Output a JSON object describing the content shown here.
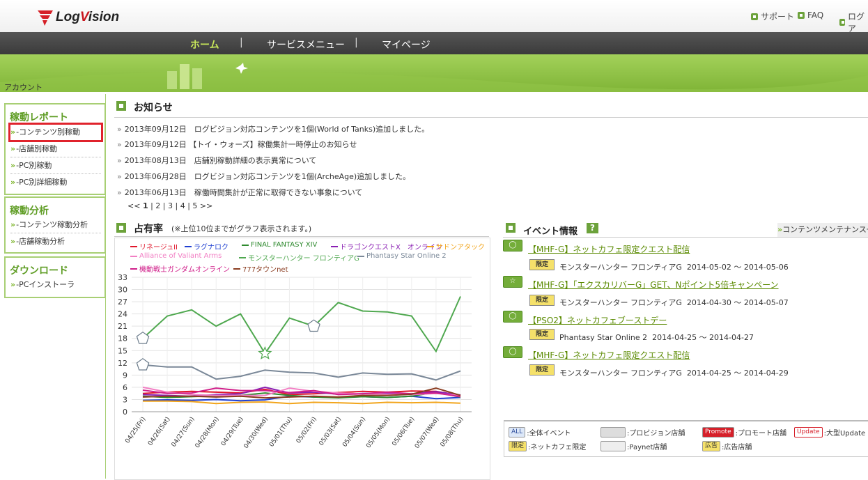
{
  "header": {
    "logo": "LogVision",
    "top_links": [
      "サポート",
      "FAQ",
      "ログア"
    ]
  },
  "nav": {
    "items": [
      "ホーム",
      "サービスメニュー",
      "マイページ"
    ],
    "active": "ホーム",
    "separator": "|"
  },
  "breadcrumb": "アカウント",
  "sidebar": {
    "sections": [
      {
        "title": "稼動レポート",
        "items": [
          "-コンテンツ別稼動",
          "-店舗別稼動",
          "-PC別稼動",
          "-PC別詳細稼動"
        ]
      },
      {
        "title": "稼動分析",
        "items": [
          "-コンテンツ稼動分析",
          "-店舗稼動分析"
        ]
      },
      {
        "title": "ダウンロード",
        "items": [
          "-PCインストーラ"
        ]
      }
    ]
  },
  "news": {
    "title": "お知らせ",
    "items": [
      "2013年09月12日　ログビジョン対応コンテンツを1個(World of Tanks)追加しました。",
      "2013年09月12日 【トイ・ウォーズ】稼働集計一時停止のお知らせ",
      "2013年08月13日　店舗別稼動詳細の表示異常について",
      "2013年06月28日　ログビジョン対応コンテンツを1個(ArcheAge)追加しました。",
      "2013年06月13日　稼働時間集計が正常に取得できない事象について"
    ],
    "pager": {
      "prev": "<<",
      "pages": [
        "1",
        "2",
        "3",
        "4",
        "5"
      ],
      "next": ">>",
      "current": "1"
    }
  },
  "share": {
    "title": "占有率",
    "note": "(※上位10位までがグラフ表示されます。)"
  },
  "chart_data": {
    "type": "line",
    "x": [
      "04/25(Fri)",
      "04/26(Sat)",
      "04/27(Sun)",
      "04/28(Mon)",
      "04/29(Tue)",
      "04/30(Wed)",
      "05/01(Thu)",
      "05/02(Fri)",
      "05/03(Sat)",
      "05/04(Sun)",
      "05/05(Mon)",
      "05/06(Tue)",
      "05/07(Wed)",
      "05/08(Thu)"
    ],
    "ylim": [
      0,
      33
    ],
    "yticks": [
      0,
      3,
      6,
      9,
      12,
      15,
      18,
      21,
      24,
      27,
      30,
      33
    ],
    "grid": true,
    "legend_position": "top",
    "series": [
      {
        "name": "リネージュII",
        "color": "#e0162b",
        "values": [
          4.5,
          4.8,
          5.0,
          4.8,
          4.6,
          5.5,
          4.2,
          4.4,
          4.7,
          5.0,
          4.8,
          5.1,
          5.0,
          4.0
        ]
      },
      {
        "name": "ラグナロク",
        "color": "#1f3fd1",
        "values": [
          2.8,
          2.9,
          2.8,
          3.0,
          2.7,
          2.9,
          3.8,
          3.6,
          3.5,
          3.7,
          3.5,
          3.8,
          3.2,
          3.5
        ]
      },
      {
        "name": "FINAL FANTASY XIV",
        "color": "#2f8a2f",
        "values": [
          3.8,
          3.5,
          3.7,
          3.9,
          4.0,
          4.6,
          4.0,
          3.6,
          3.4,
          3.7,
          3.5,
          3.8,
          4.8,
          3.6
        ]
      },
      {
        "name": "ドラゴンクエストX　オンライン",
        "color": "#8a1fb3",
        "values": [
          4.2,
          4.0,
          3.8,
          4.2,
          4.4,
          6.0,
          4.6,
          4.8,
          4.3,
          4.5,
          4.6,
          4.4,
          4.9,
          4.1
        ]
      },
      {
        "name": "サドンアタック",
        "color": "#f2a51c",
        "values": [
          2.6,
          2.6,
          2.5,
          2.0,
          2.3,
          2.4,
          2.0,
          2.3,
          2.2,
          2.0,
          2.3,
          2.2,
          2.3,
          2.1
        ]
      },
      {
        "name": "Alliance of Valiant Arms",
        "color": "#f27fc4",
        "values": [
          6.0,
          4.8,
          4.2,
          4.0,
          4.0,
          4.0,
          5.8,
          5.0,
          4.6,
          4.4,
          4.3,
          4.2,
          4.5,
          4.0
        ]
      },
      {
        "name": "モンスターハンター フロンティアG",
        "color": "#4fa84f",
        "values": [
          18.0,
          23.5,
          25.0,
          21.0,
          24.0,
          14.3,
          23.0,
          21.0,
          26.8,
          24.7,
          24.5,
          23.5,
          14.8,
          28.3
        ]
      },
      {
        "name": "Phantasy Star Online 2",
        "color": "#7a8898",
        "values": [
          11.5,
          11.0,
          11.0,
          8.0,
          8.7,
          10.2,
          9.7,
          9.5,
          8.5,
          9.5,
          9.2,
          9.3,
          7.8,
          10.0
        ]
      },
      {
        "name": "機動戦士ガンダムオンライン",
        "color": "#d01f8a",
        "values": [
          5.3,
          4.5,
          4.6,
          5.8,
          5.2,
          5.2,
          4.7,
          5.2,
          4.2,
          4.4,
          4.8,
          4.4,
          4.6,
          3.7
        ]
      },
      {
        "name": "777タウンnet",
        "color": "#8a3b1f",
        "values": [
          3.6,
          3.8,
          3.8,
          3.6,
          3.8,
          3.4,
          3.6,
          3.8,
          3.6,
          4.0,
          4.0,
          4.3,
          5.8,
          4.0
        ]
      }
    ]
  },
  "events": {
    "title": "イベント情報",
    "help": "?",
    "maint_link": "コンテンツメンテナンス一覧",
    "items": [
      {
        "badge": "◯",
        "title": "【MHF-G】ネットカフェ限定クエスト配信",
        "tag": "限定",
        "game": "モンスターハンター フロンティアG",
        "period": "2014-05-02 ～ 2014-05-06"
      },
      {
        "badge": "☆",
        "title": "【MHF-G】「エクスカリバーG」GET、Nポイント5倍キャンペーン",
        "tag": "限定",
        "game": "モンスターハンター フロンティアG",
        "period": "2014-04-30 ～ 2014-05-07"
      },
      {
        "badge": "◯",
        "title": "【PSO2】ネットカフェブーストデー",
        "tag": "限定",
        "game": "Phantasy Star Online 2",
        "period": "2014-04-25 ～ 2014-04-27"
      },
      {
        "badge": "◯",
        "title": "【MHF-G】ネットカフェ限定クエスト配信",
        "tag": "限定",
        "game": "モンスターハンター フロンティアG",
        "period": "2014-04-25 ～ 2014-04-29"
      }
    ],
    "legend": [
      {
        "badge": "ALL",
        "label": ":全体イベント"
      },
      {
        "badge": "",
        "label": ":プロビジョン店舗"
      },
      {
        "badge": "Promote",
        "label": ":プロモート店舗"
      },
      {
        "badge": "Update",
        "label": ":大型Update"
      },
      {
        "badge": "限定",
        "label": ":ネットカフェ限定"
      },
      {
        "badge": "",
        "label": ":Paynet店舗"
      },
      {
        "badge": "広告",
        "label": ":広告店舗"
      }
    ]
  }
}
